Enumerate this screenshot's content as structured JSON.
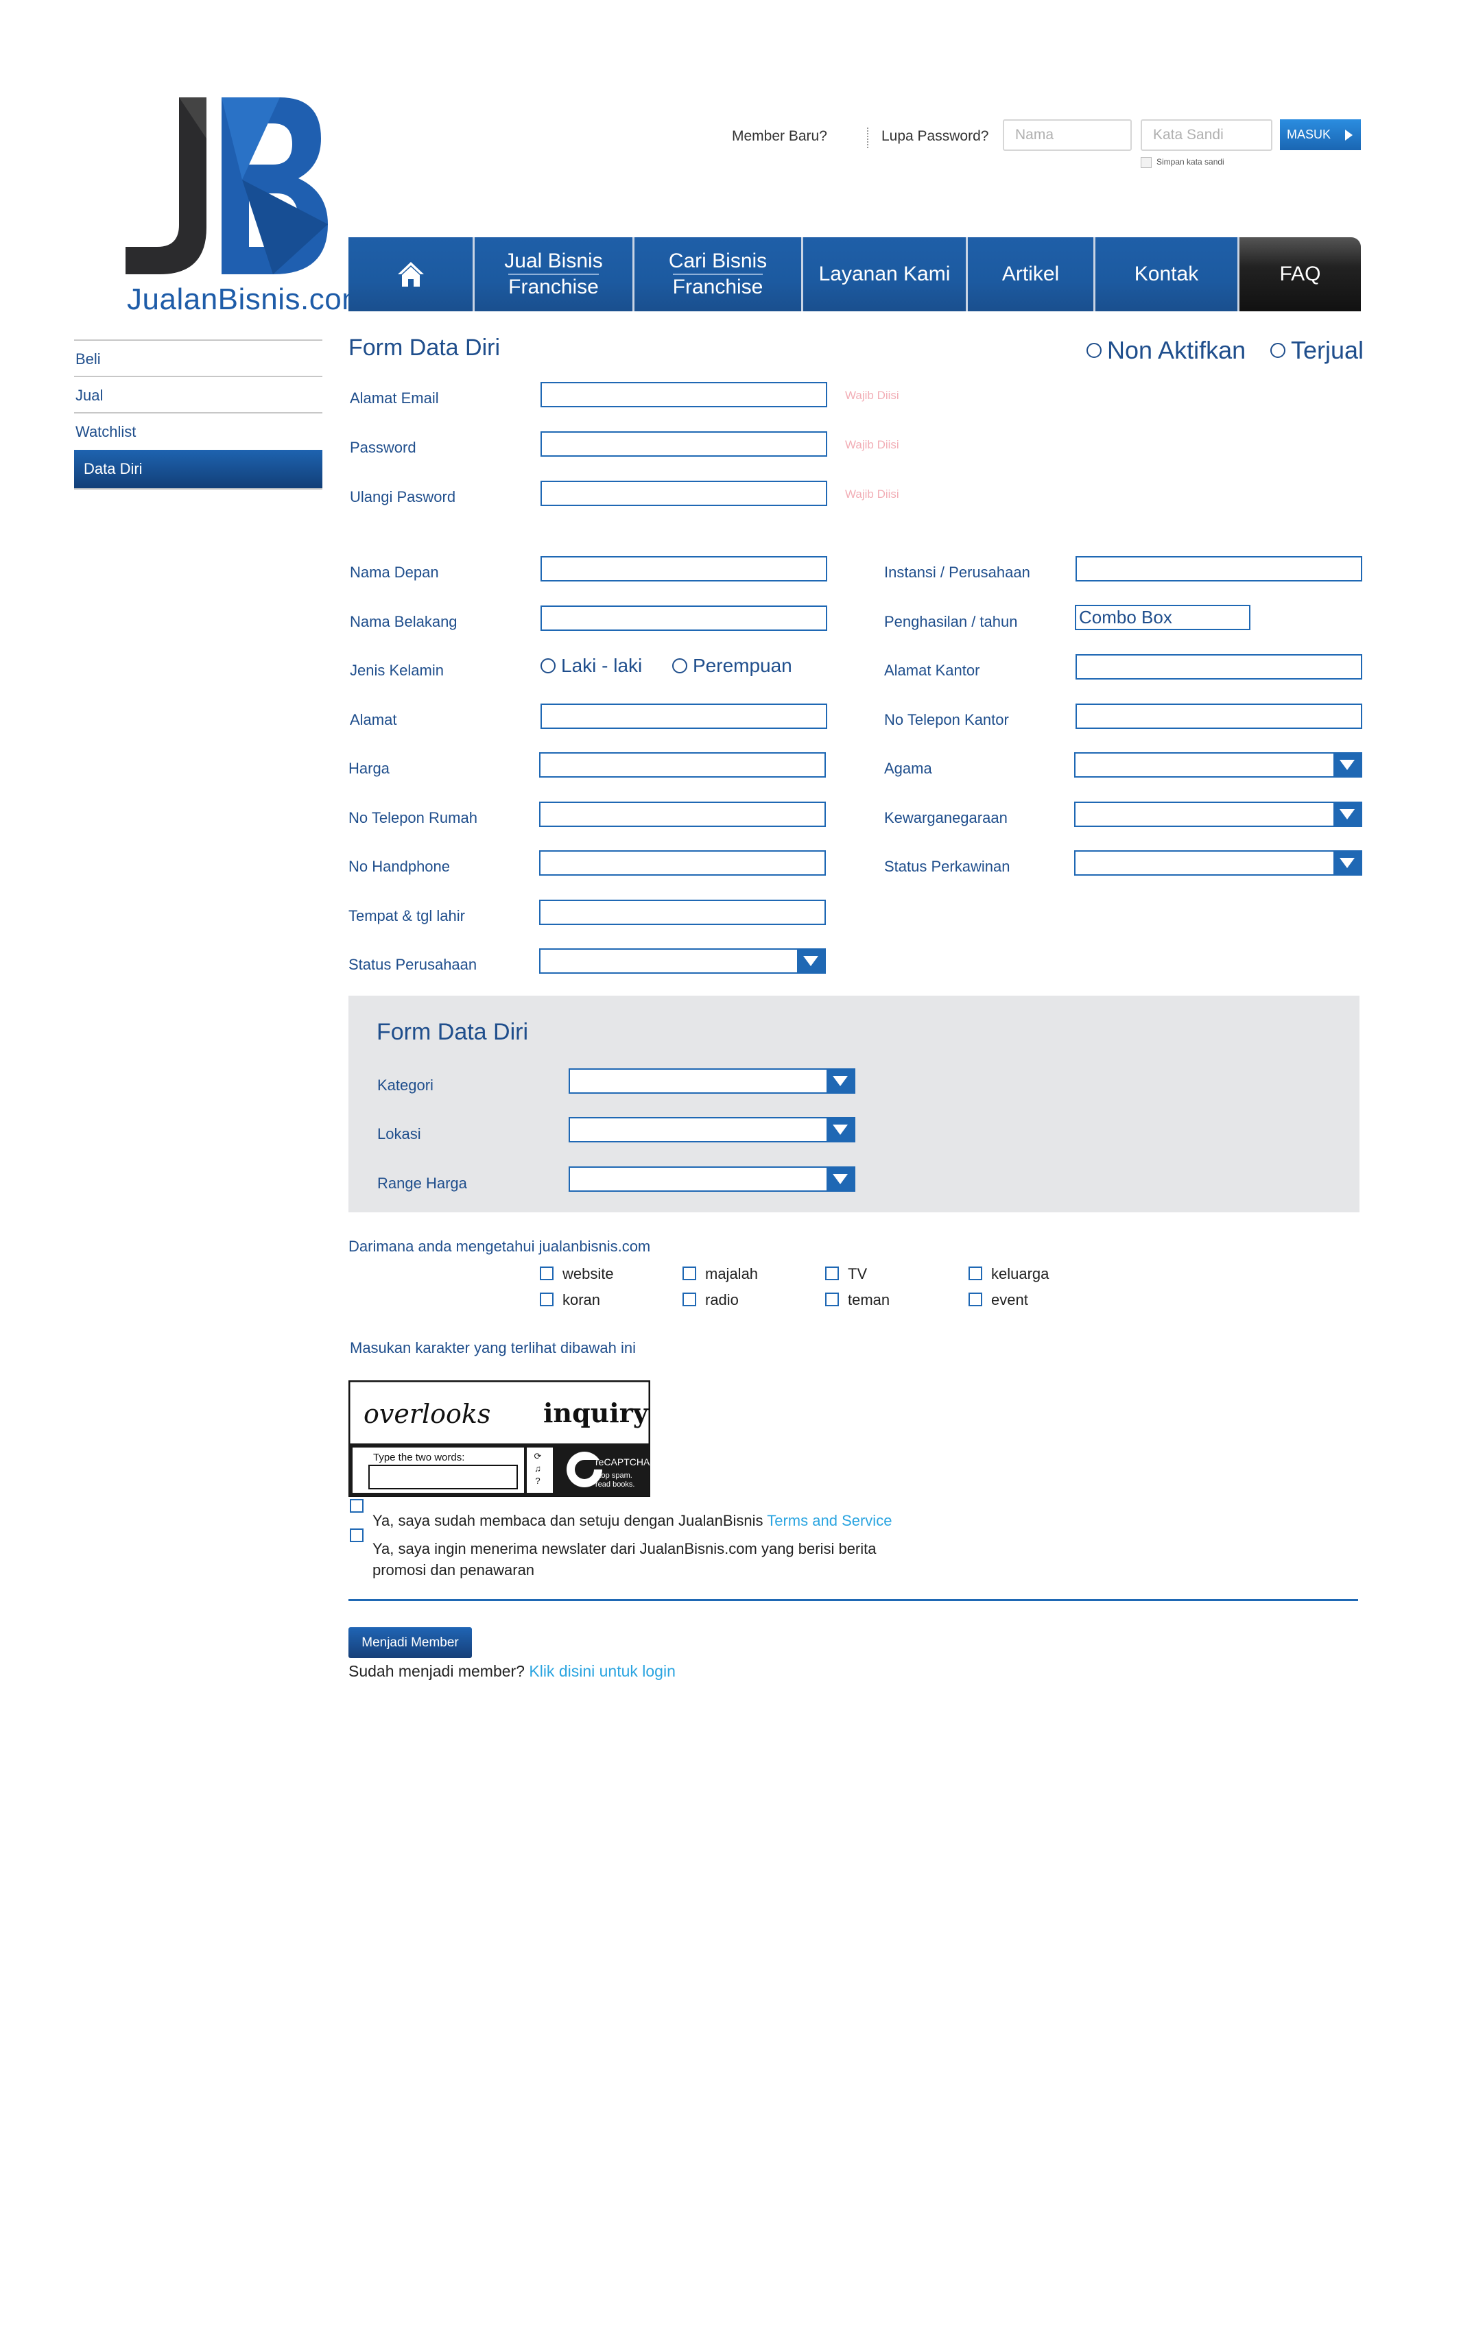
{
  "logo": {
    "text": "JualanBisnis.com",
    "mark": "JB"
  },
  "login": {
    "member_baru": "Member Baru?",
    "lupa_password": "Lupa Password?",
    "nama_placeholder": "Nama",
    "sandi_placeholder": "Kata Sandi",
    "masuk_label": "MASUK",
    "remember_label": "Simpan kata sandi"
  },
  "nav": {
    "home_icon": "home-icon",
    "items": [
      {
        "line1": "Jual Bisnis",
        "line2": "Franchise"
      },
      {
        "line1": "Cari Bisnis",
        "line2": "Franchise"
      },
      {
        "line1": "Layanan Kami"
      },
      {
        "line1": "Artikel"
      },
      {
        "line1": "Kontak"
      },
      {
        "line1": "FAQ"
      }
    ]
  },
  "sidebar": {
    "items": [
      {
        "label": "Beli"
      },
      {
        "label": "Jual"
      },
      {
        "label": "Watchlist"
      },
      {
        "label": "Data Diri"
      }
    ]
  },
  "form": {
    "title": "Form Data Diri",
    "status_options": [
      "Non Aktifkan",
      "Terjual"
    ],
    "account": [
      {
        "label": "Alamat Email",
        "note": "Wajib Diisi"
      },
      {
        "label": "Password",
        "note": "Wajib Diisi"
      },
      {
        "label": "Ulangi Pasword",
        "note": "Wajib Diisi"
      }
    ],
    "left_labels": [
      "Nama Depan",
      "Nama Belakang",
      "Jenis Kelamin",
      "Alamat",
      "Harga",
      "No Telepon Rumah",
      "No Handphone",
      "Tempat & tgl lahir",
      "Status Perusahaan"
    ],
    "gender_options": [
      "Laki - laki",
      "Perempuan"
    ],
    "right_labels": [
      "Instansi / Perusahaan",
      "Penghasilan / tahun",
      "Alamat Kantor",
      "No Telepon Kantor",
      "Agama",
      "Kewarganegaraan",
      "Status Perkawinan"
    ],
    "combo_box_value": "Combo Box"
  },
  "preference": {
    "title": "Form Data Diri",
    "labels": [
      "Kategori",
      "Lokasi",
      "Range Harga"
    ]
  },
  "source": {
    "question": "Darimana anda mengetahui jualanbisnis.com",
    "options": [
      "website",
      "majalah",
      "TV",
      "keluarga",
      "koran",
      "radio",
      "teman",
      "event"
    ]
  },
  "captcha": {
    "instruction": "Masukan karakter yang terlihat dibawah ini",
    "word1": "overlooks",
    "word2": "inquiry",
    "input_placeholder": "Type the two words:",
    "brand": "reCAPTCHA",
    "tagline": "stop spam. read books."
  },
  "agreements": {
    "terms_text": "Ya, saya sudah membaca dan setuju dengan JualanBisnis",
    "terms_link": "Terms and Service",
    "newsletter_text": "Ya, saya ingin menerima newslater dari JualanBisnis.com yang berisi berita promosi dan penawaran"
  },
  "footer": {
    "join_button": "Menjadi Member",
    "already_member": "Sudah menjadi member?",
    "login_link": "Klik disini untuk login"
  },
  "colors": {
    "primary": "#1f4e8c",
    "accent": "#1f68b4",
    "link": "#2aa4e0",
    "required_note": "#f2aeb6"
  }
}
